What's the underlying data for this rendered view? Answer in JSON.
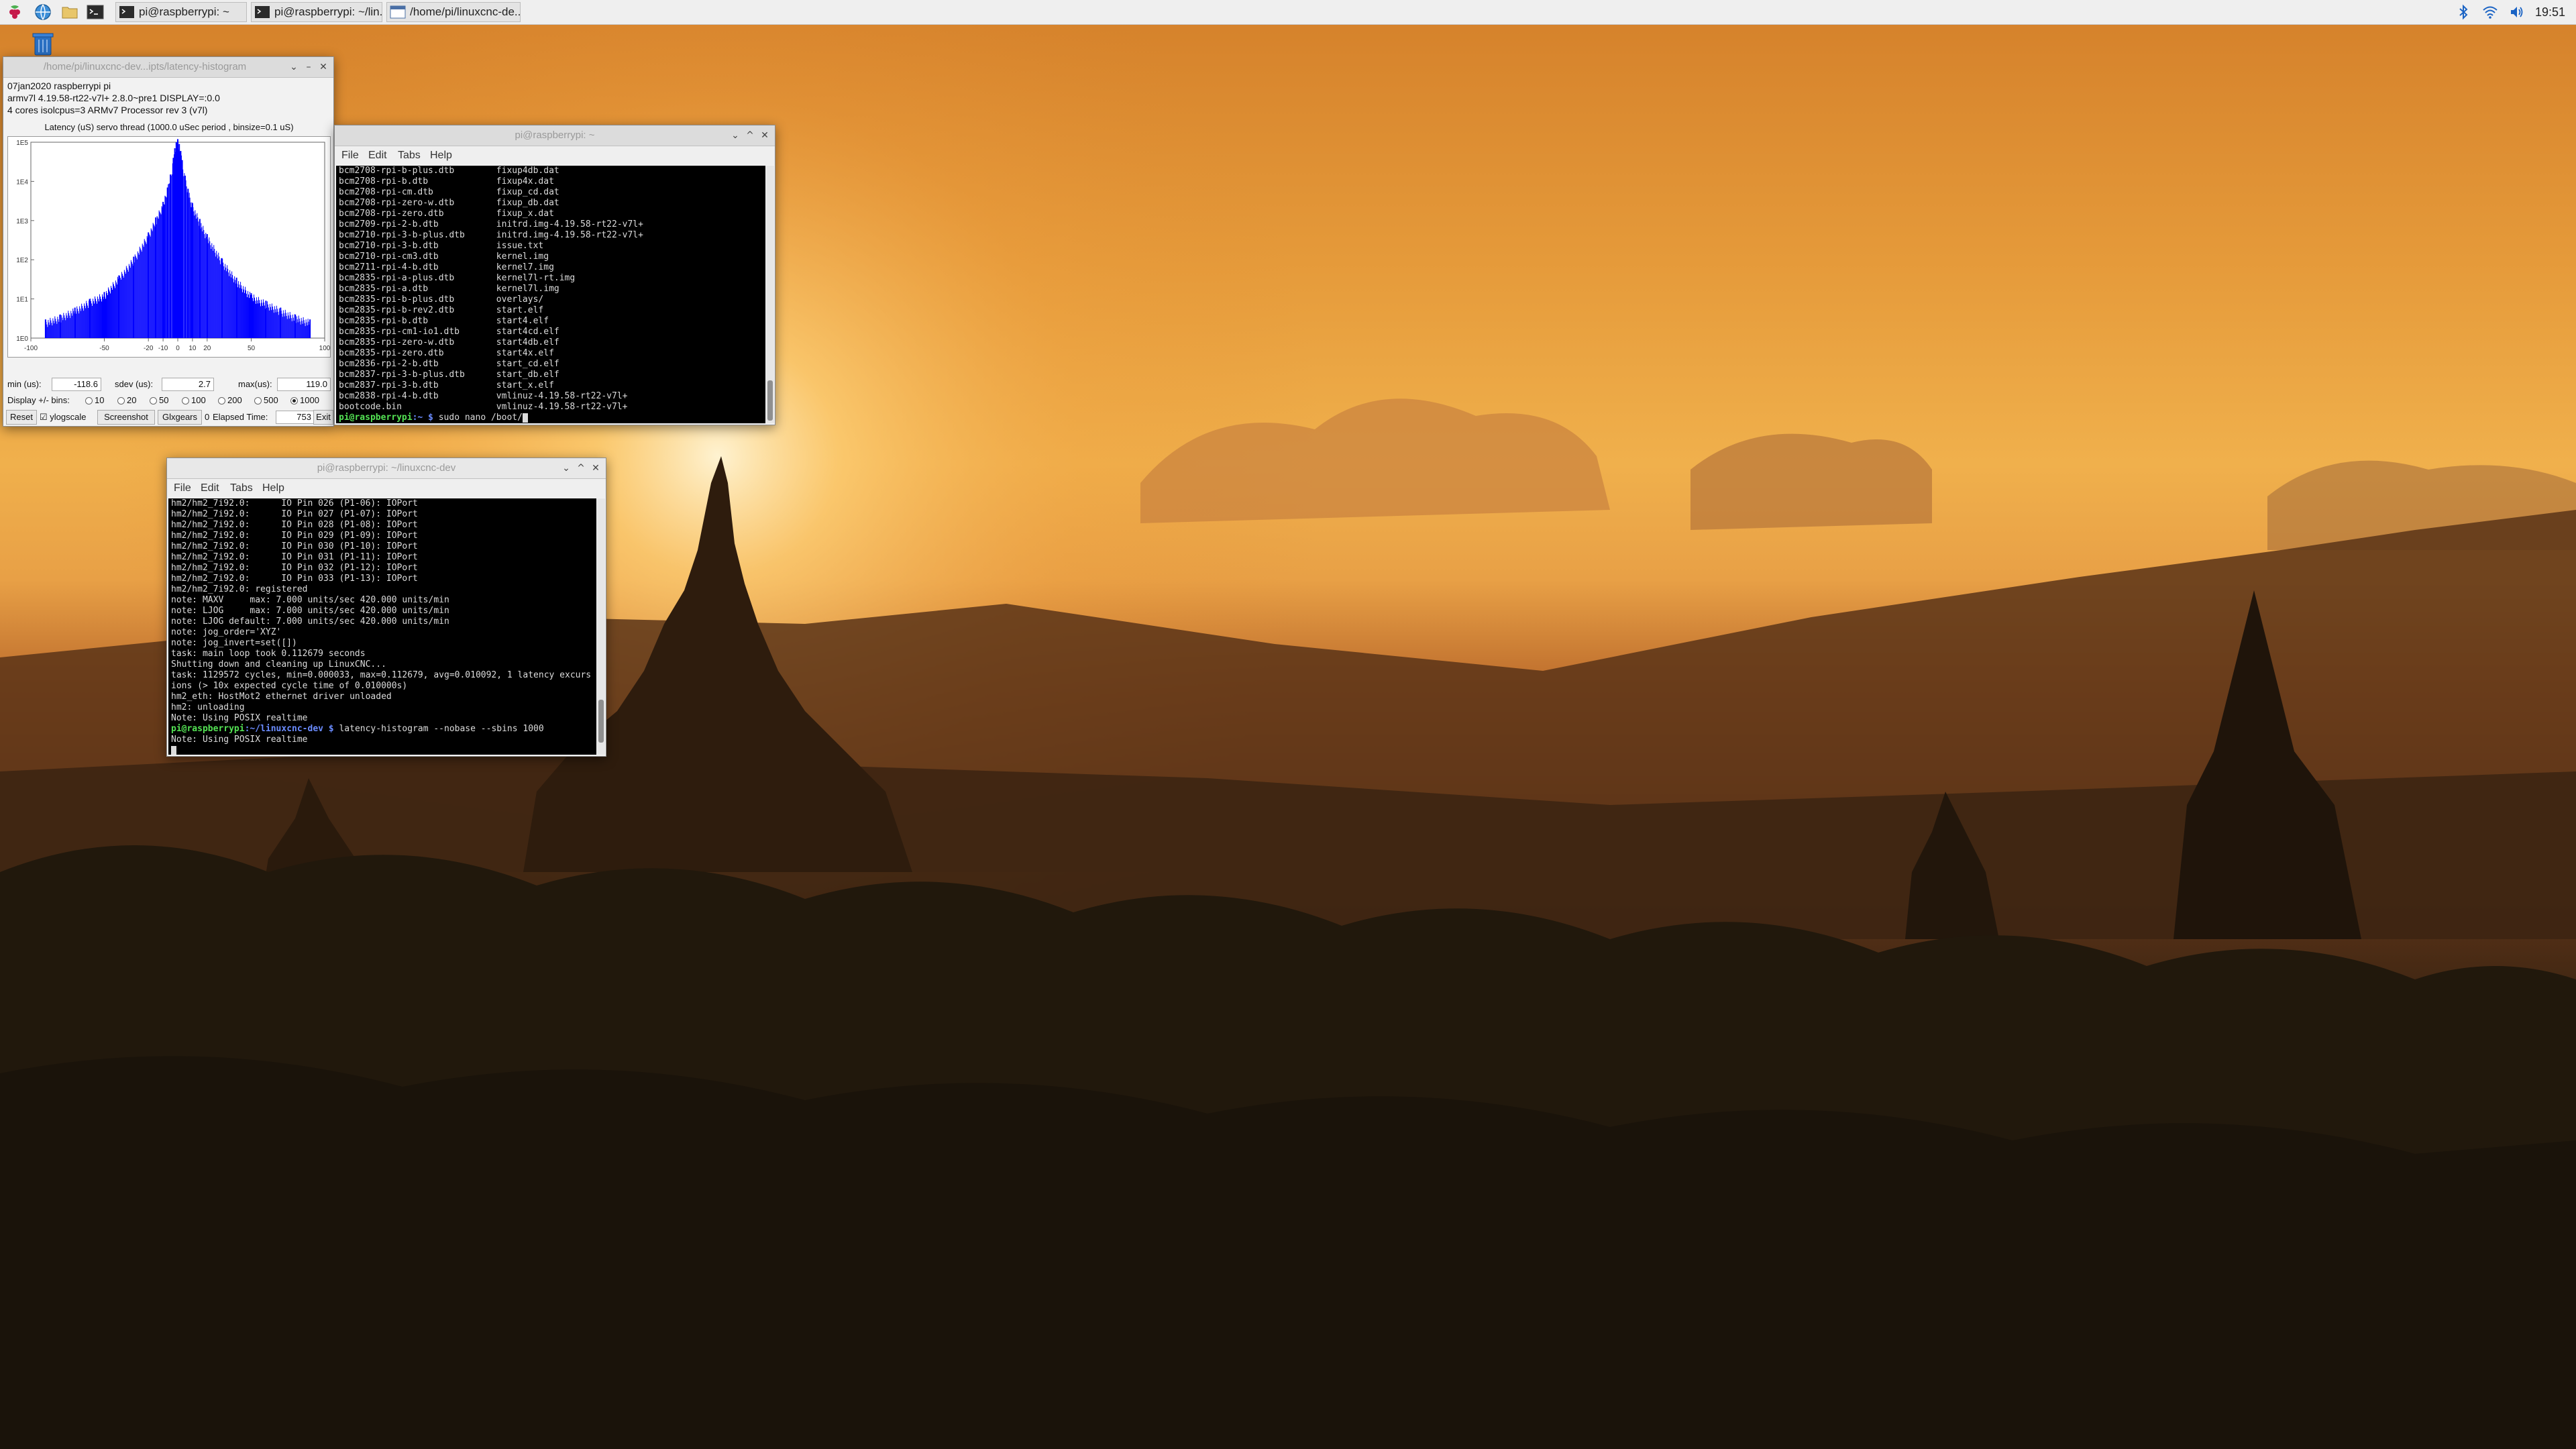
{
  "taskbar": {
    "launchers": [
      {
        "name": "raspberry-menu-icon"
      },
      {
        "name": "web-browser-icon"
      },
      {
        "name": "file-manager-icon"
      },
      {
        "name": "terminal-icon"
      }
    ],
    "tasks": [
      {
        "label": "pi@raspberrypi: ~",
        "icon": "terminal-icon"
      },
      {
        "label": "pi@raspberrypi: ~/lin...",
        "icon": "terminal-icon"
      },
      {
        "label": "/home/pi/linuxcnc-de...",
        "icon": "window-icon"
      }
    ],
    "tray": [
      "bluetooth-icon",
      "wifi-icon",
      "volume-icon"
    ],
    "clock": "19:51"
  },
  "histogram_window": {
    "title": "/home/pi/linuxcnc-dev...ipts/latency-histogram",
    "info_lines": [
      "07jan2020 raspberrypi pi",
      "armv7l  4.19.58-rt22-v7l+  2.8.0~pre1  DISPLAY=:0.0",
      "4 cores  isolcpus=3   ARMv7 Processor rev 3 (v7l)"
    ],
    "plot_title": "Latency (uS) servo thread (1000.0 uSec period , binsize=0.1 uS)",
    "y_tick_labels": [
      "1E5",
      "1E4",
      "1E3",
      "1E2",
      "1E1",
      "1E0"
    ],
    "x_tick_labels": [
      "-100",
      "-50",
      "-20",
      "-10",
      "0",
      "10",
      "20",
      "50",
      "100"
    ],
    "stats": {
      "min_label": "min (us):",
      "min_value": "-118.6",
      "sdev_label": "sdev (us):",
      "sdev_value": "2.7",
      "max_label": "max(us):",
      "max_value": "119.0"
    },
    "bins_label": "Display +/- bins:",
    "bins_options": [
      "10",
      "20",
      "50",
      "100",
      "200",
      "500",
      "1000"
    ],
    "bins_selected": "1000",
    "buttons": {
      "reset": "Reset",
      "ylogscale": "ylogscale",
      "screenshot": "Screenshot",
      "glxgears": "Glxgears",
      "glxgears_count": "0",
      "elapsed_label": "Elapsed Time:",
      "elapsed_value": "753",
      "exit": "Exit"
    },
    "ylogscale_checked": true
  },
  "chart_data": {
    "type": "bar",
    "title": "Latency (uS) servo thread (1000.0 uSec period , binsize=0.1 uS)",
    "xlabel": "",
    "ylabel": "",
    "xlim": [
      -100,
      100
    ],
    "yscale": "log",
    "ylim": [
      1,
      100000
    ],
    "series": [
      {
        "color": "#0000ff",
        "points": [
          [
            -90,
            3
          ],
          [
            -80,
            4
          ],
          [
            -70,
            6
          ],
          [
            -60,
            10
          ],
          [
            -50,
            15
          ],
          [
            -40,
            40
          ],
          [
            -30,
            120
          ],
          [
            -20,
            500
          ],
          [
            -15,
            1200
          ],
          [
            -10,
            3000
          ],
          [
            -7,
            7000
          ],
          [
            -5,
            15000
          ],
          [
            -3,
            40000
          ],
          [
            -2,
            70000
          ],
          [
            -1,
            100000
          ],
          [
            0,
            120000
          ],
          [
            1,
            90000
          ],
          [
            2,
            60000
          ],
          [
            3,
            35000
          ],
          [
            5,
            14000
          ],
          [
            7,
            6500
          ],
          [
            10,
            2800
          ],
          [
            15,
            1100
          ],
          [
            20,
            450
          ],
          [
            30,
            110
          ],
          [
            40,
            35
          ],
          [
            50,
            14
          ],
          [
            60,
            9
          ],
          [
            70,
            6
          ],
          [
            80,
            4
          ],
          [
            90,
            3
          ]
        ]
      }
    ]
  },
  "terminal_top": {
    "title": "pi@raspberrypi: ~",
    "menu": [
      "File",
      "Edit",
      "Tabs",
      "Help"
    ],
    "columns": [
      [
        "bcm2708-rpi-b-plus.dtb",
        "fixup4db.dat"
      ],
      [
        "bcm2708-rpi-b.dtb",
        "fixup4x.dat"
      ],
      [
        "bcm2708-rpi-cm.dtb",
        "fixup_cd.dat"
      ],
      [
        "bcm2708-rpi-zero-w.dtb",
        "fixup_db.dat"
      ],
      [
        "bcm2708-rpi-zero.dtb",
        "fixup_x.dat"
      ],
      [
        "bcm2709-rpi-2-b.dtb",
        "initrd.img-4.19.58-rt22-v7l+"
      ],
      [
        "bcm2710-rpi-3-b-plus.dtb",
        "initrd.img-4.19.58-rt22-v7l+"
      ],
      [
        "bcm2710-rpi-3-b.dtb",
        "issue.txt"
      ],
      [
        "bcm2710-rpi-cm3.dtb",
        "kernel.img"
      ],
      [
        "bcm2711-rpi-4-b.dtb",
        "kernel7.img"
      ],
      [
        "bcm2835-rpi-a-plus.dtb",
        "kernel7l-rt.img"
      ],
      [
        "bcm2835-rpi-a.dtb",
        "kernel7l.img"
      ],
      [
        "bcm2835-rpi-b-plus.dtb",
        "overlays/"
      ],
      [
        "bcm2835-rpi-b-rev2.dtb",
        "start.elf"
      ],
      [
        "bcm2835-rpi-b.dtb",
        "start4.elf"
      ],
      [
        "bcm2835-rpi-cm1-io1.dtb",
        "start4cd.elf"
      ],
      [
        "bcm2835-rpi-zero-w.dtb",
        "start4db.elf"
      ],
      [
        "bcm2835-rpi-zero.dtb",
        "start4x.elf"
      ],
      [
        "bcm2836-rpi-2-b.dtb",
        "start_cd.elf"
      ],
      [
        "bcm2837-rpi-3-b-plus.dtb",
        "start_db.elf"
      ],
      [
        "bcm2837-rpi-3-b.dtb",
        "start_x.elf"
      ],
      [
        "bcm2838-rpi-4-b.dtb",
        "vmlinuz-4.19.58-rt22-v7l+"
      ],
      [
        "bootcode.bin",
        "vmlinuz-4.19.58-rt22-v7l+"
      ]
    ],
    "prompt_user": "pi@raspberrypi",
    "prompt_path": ":~ $",
    "command": " sudo nano /boot/"
  },
  "terminal_bottom": {
    "title": "pi@raspberrypi: ~/linuxcnc-dev",
    "menu": [
      "File",
      "Edit",
      "Tabs",
      "Help"
    ],
    "lines": [
      "hm2/hm2_7i92.0:      IO Pin 026 (P1-06): IOPort",
      "hm2/hm2_7i92.0:      IO Pin 027 (P1-07): IOPort",
      "hm2/hm2_7i92.0:      IO Pin 028 (P1-08): IOPort",
      "hm2/hm2_7i92.0:      IO Pin 029 (P1-09): IOPort",
      "hm2/hm2_7i92.0:      IO Pin 030 (P1-10): IOPort",
      "hm2/hm2_7i92.0:      IO Pin 031 (P1-11): IOPort",
      "hm2/hm2_7i92.0:      IO Pin 032 (P1-12): IOPort",
      "hm2/hm2_7i92.0:      IO Pin 033 (P1-13): IOPort",
      "hm2/hm2_7i92.0: registered",
      "note: MAXV     max: 7.000 units/sec 420.000 units/min",
      "note: LJOG     max: 7.000 units/sec 420.000 units/min",
      "note: LJOG default: 7.000 units/sec 420.000 units/min",
      "note: jog_order='XYZ'",
      "note: jog_invert=set([])",
      "task: main loop took 0.112679 seconds",
      "Shutting down and cleaning up LinuxCNC...",
      "task: 1129572 cycles, min=0.000033, max=0.112679, avg=0.010092, 1 latency excurs",
      "ions (> 10x expected cycle time of 0.010000s)",
      "hm2_eth: HostMot2 ethernet driver unloaded",
      "hm2: unloading",
      "Note: Using POSIX realtime"
    ],
    "prompt_user": "pi@raspberrypi",
    "prompt_path": ":~/linuxcnc-dev $",
    "command": " latency-histogram --nobase --sbins 1000",
    "after_line": "Note: Using POSIX realtime"
  },
  "colors": {
    "histogram_bars": "#0000ff",
    "prompt_user": "#54e354",
    "prompt_path": "#6b8cff"
  }
}
